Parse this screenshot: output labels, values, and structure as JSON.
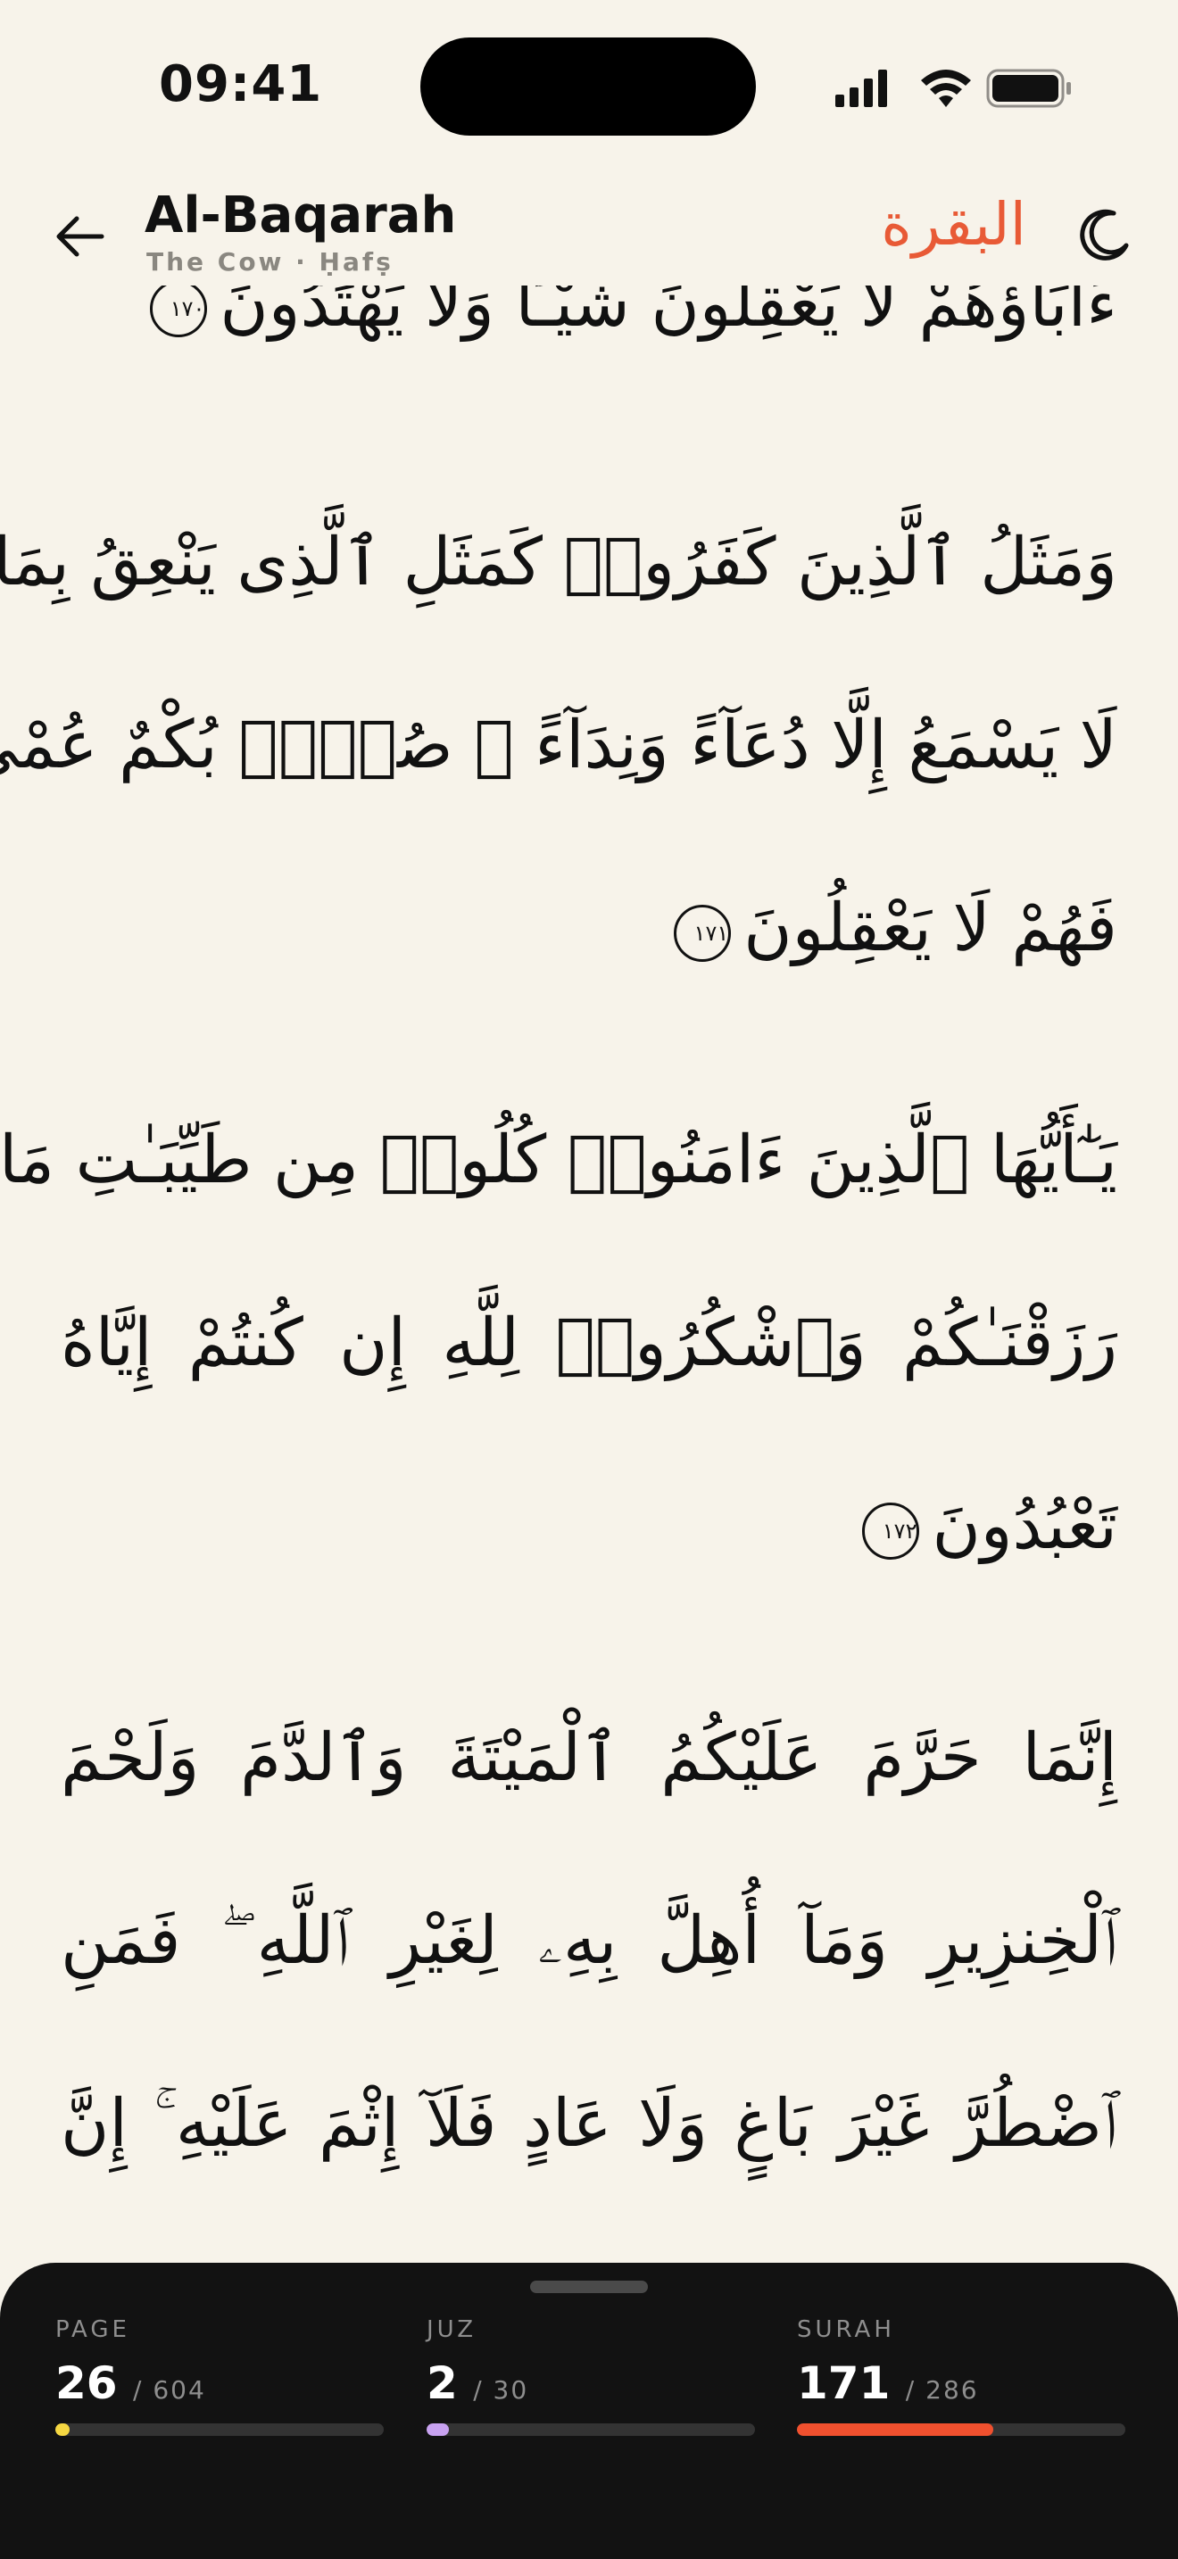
{
  "status": {
    "time": "09:41"
  },
  "header": {
    "title": "Al-Baqarah",
    "subtitle": "The Cow · Ḥafṣ",
    "arabic_title": "البقرة"
  },
  "verses": {
    "partial_line": "ءَابَآؤُهُمْ لَا يَعْقِلُونَ شَيْـًٔا وَلَا يَهْتَدُونَ",
    "partial_marker": "١٧٠",
    "v171": {
      "lines": [
        "وَمَثَلُ ٱلَّذِينَ كَفَرُوا۟ كَمَثَلِ ٱلَّذِى يَنْعِقُ بِمَا",
        "لَا يَسْمَعُ إِلَّا دُعَآءً وَنِدَآءً ۚ صُمٌّۢ بُكْمٌ عُمْىٌ",
        "فَهُمْ لَا يَعْقِلُونَ"
      ],
      "marker": "١٧١"
    },
    "v172": {
      "lines": [
        "يَـٰٓأَيُّهَا ٱلَّذِينَ ءَامَنُوا۟ كُلُوا۟ مِن طَيِّبَـٰتِ مَا",
        "رَزَقْنَـٰكُمْ وَٱشْكُرُوا۟ لِلَّهِ إِن كُنتُمْ إِيَّاهُ",
        "تَعْبُدُونَ"
      ],
      "marker": "١٧٢"
    },
    "v173": {
      "lines": [
        "إِنَّمَا حَرَّمَ عَلَيْكُمُ ٱلْمَيْتَةَ وَٱلدَّمَ وَلَحْمَ",
        "ٱلْخِنزِيرِ وَمَآ أُهِلَّ بِهِۦ لِغَيْرِ ٱللَّهِ ۖ فَمَنِ",
        "ٱضْطُرَّ غَيْرَ بَاغٍ وَلَا عَادٍ فَلَآ إِثْمَ عَلَيْهِ ۚ إِنَّ"
      ]
    }
  },
  "progress": {
    "page": {
      "label": "PAGE",
      "value": "26",
      "total": "/ 604",
      "fraction": 0.043,
      "color": "#F5D742"
    },
    "juz": {
      "label": "JUZ",
      "value": "2",
      "total": "/ 30",
      "fraction": 0.067,
      "color": "#C8A2F0"
    },
    "surah": {
      "label": "SURAH",
      "value": "171",
      "total": "/ 286",
      "fraction": 0.598,
      "color": "#F0502E"
    }
  }
}
